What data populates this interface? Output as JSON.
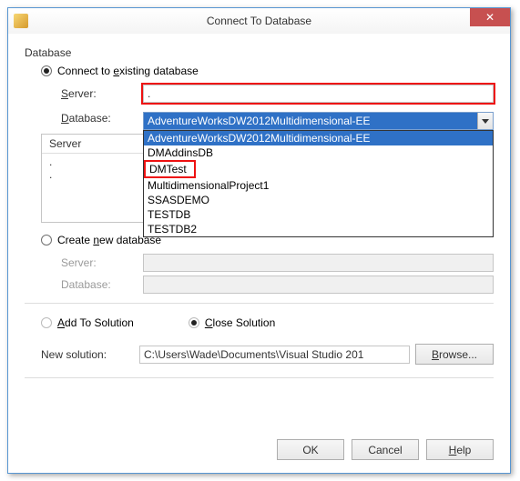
{
  "window": {
    "title": "Connect To Database",
    "close_glyph": "✕"
  },
  "group_label": "Database",
  "existing": {
    "radio_label_pre": "Connect to ",
    "radio_label_u": "e",
    "radio_label_post": "xisting database",
    "server_label_pre": "",
    "server_label_u": "S",
    "server_label_post": "erver:",
    "server_value": ".",
    "database_label_pre": "",
    "database_label_u": "D",
    "database_label_post": "atabase:",
    "combo_selected": "AdventureWorksDW2012Multidimensional-EE",
    "combo_options": [
      "AdventureWorksDW2012Multidimensional-EE",
      "DMAddinsDB",
      "DMTest",
      "MultidimensionalProject1",
      "SSASDEMO",
      "TESTDB",
      "TESTDB2"
    ],
    "listbox_header": "Server",
    "listbox_rows": [
      ".",
      "."
    ]
  },
  "newdb": {
    "radio_label_pre": "Create ",
    "radio_label_u": "n",
    "radio_label_post": "ew database",
    "server_label": "Server:",
    "database_label": "Database:"
  },
  "solution": {
    "add_label_u": "A",
    "add_label_post": "dd To Solution",
    "close_label_u": "C",
    "close_label_post": "lose Solution",
    "new_label": "New solution:",
    "path": "C:\\Users\\Wade\\Documents\\Visual Studio 201",
    "browse_label_u": "B",
    "browse_label_post": "rowse..."
  },
  "buttons": {
    "ok": "OK",
    "cancel": "Cancel",
    "help_u": "H",
    "help_post": "elp"
  }
}
